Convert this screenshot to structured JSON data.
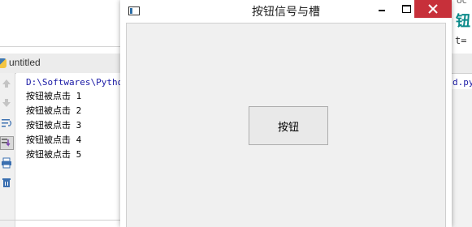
{
  "ide": {
    "tab_label": "untitled",
    "console_path": "D:\\Softwares\\Python",
    "console_lines": [
      "按钮被点击 1",
      "按钮被点击 2",
      "按钮被点击 3",
      "按钮被点击 4",
      "按钮被点击 5"
    ],
    "right_fragments": {
      "top": "oc",
      "teal": "钮",
      "eq": "t=",
      "py": "d.py"
    }
  },
  "dialog": {
    "title": "按钮信号与槽",
    "button_label": "按钮",
    "close_color": "#c7303a"
  },
  "icons": [
    "app-window-icon",
    "minimize-icon",
    "maximize-icon",
    "close-icon",
    "arrow-up-icon",
    "arrow-down-icon",
    "soft-wrap-icon",
    "scroll-to-end-icon",
    "print-icon",
    "trash-icon",
    "python-file-icon"
  ]
}
